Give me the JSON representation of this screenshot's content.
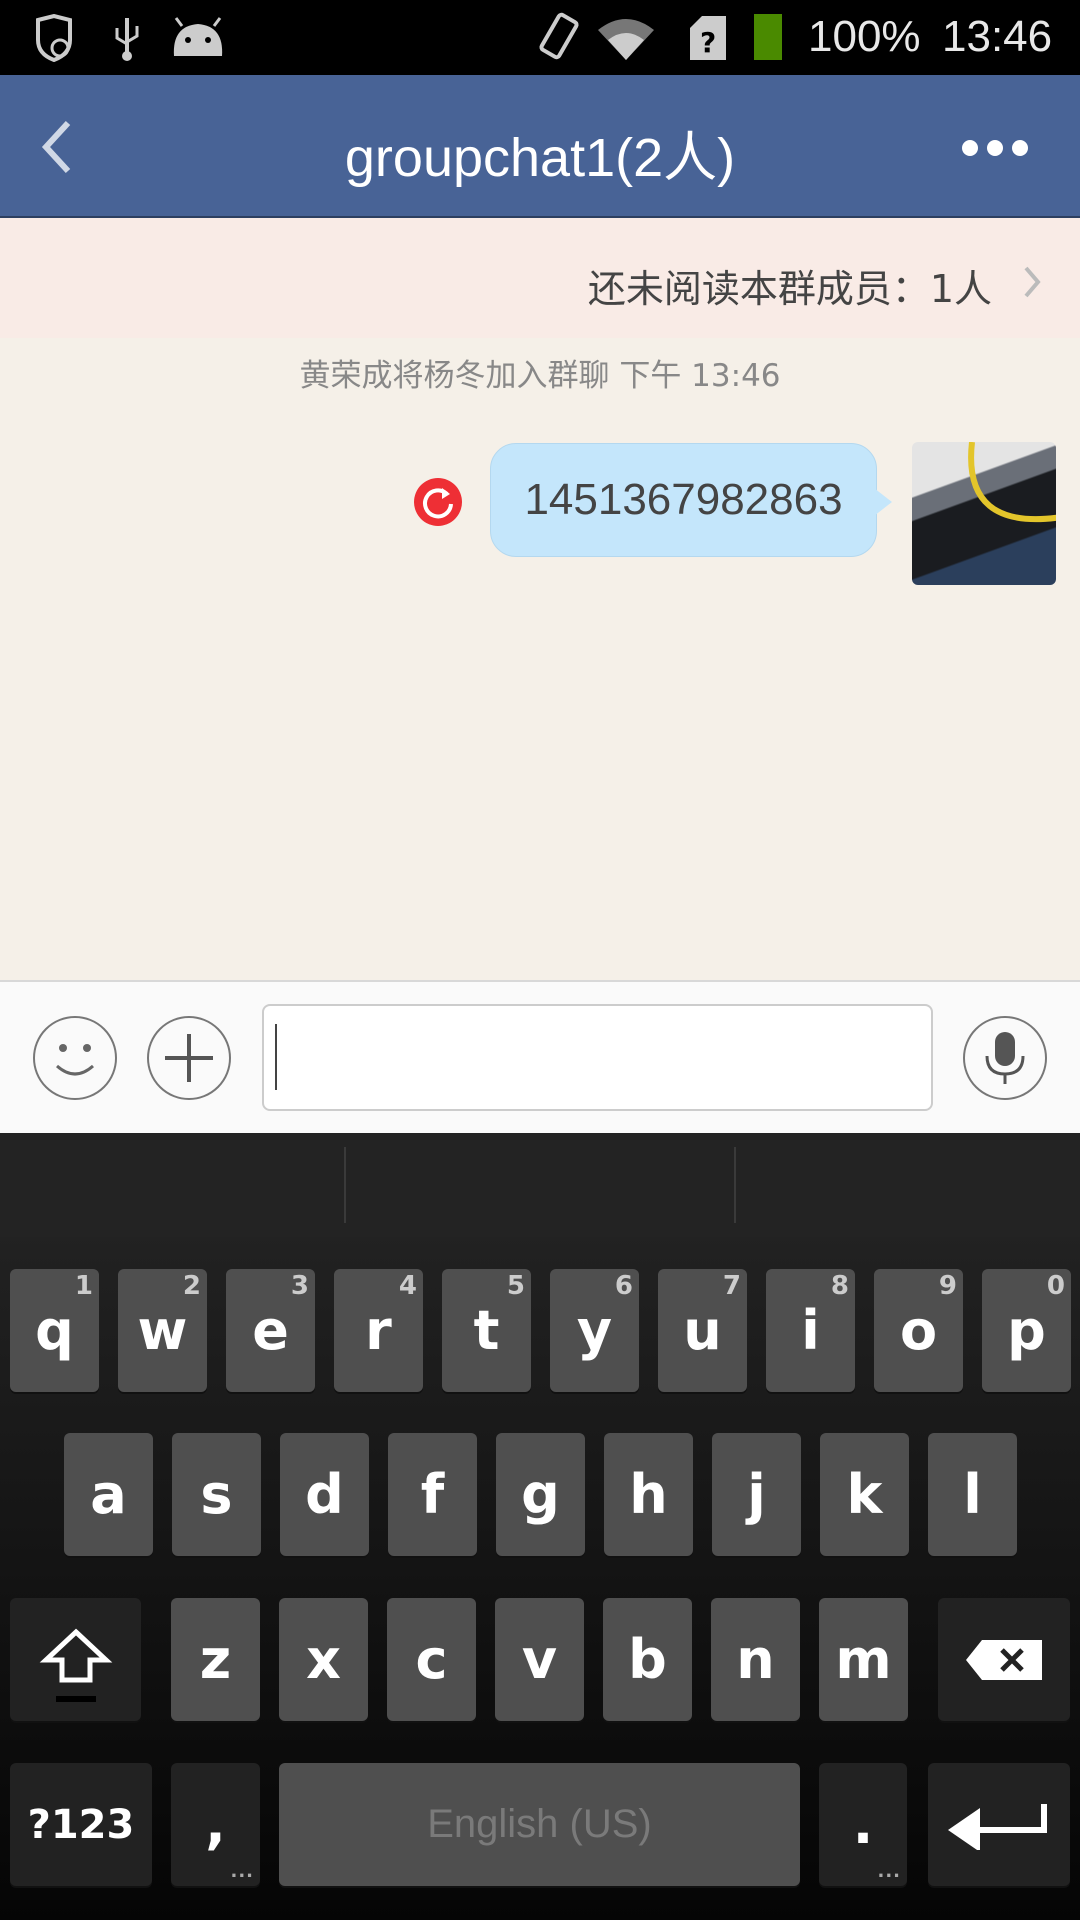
{
  "status_bar": {
    "battery": "100%",
    "time": "13:46",
    "icons": [
      "shield-icon",
      "usb-icon",
      "android-icon",
      "vibrate-icon",
      "wifi-icon",
      "sim-unknown-icon",
      "battery-icon"
    ],
    "battery_color": "#4a8a00"
  },
  "header": {
    "title": "groupchat1(2人)",
    "back_icon": "chevron-left-icon",
    "more_icon": "more-icon",
    "color": "#486396"
  },
  "unread_banner": {
    "text": "还未阅读本群成员：1人"
  },
  "messages": {
    "system": "黄荣成将杨冬加入群聊  下午 13:46",
    "sent": {
      "text": "1451367982863",
      "status_icon": "resend-icon",
      "status_color": "#ee2f35"
    }
  },
  "input_bar": {
    "value": "",
    "emoji_icon": "emoji-icon",
    "plus_icon": "plus-icon",
    "mic_icon": "mic-icon"
  },
  "keyboard": {
    "row1": [
      "q",
      "w",
      "e",
      "r",
      "t",
      "y",
      "u",
      "i",
      "o",
      "p"
    ],
    "row1_hints": [
      "1",
      "2",
      "3",
      "4",
      "5",
      "6",
      "7",
      "8",
      "9",
      "0"
    ],
    "row2": [
      "a",
      "s",
      "d",
      "f",
      "g",
      "h",
      "j",
      "k",
      "l"
    ],
    "row3": [
      "z",
      "x",
      "c",
      "v",
      "b",
      "n",
      "m"
    ],
    "symbols": "?123",
    "comma": ",",
    "space": "English (US)",
    "period": ".",
    "more_dots": "..."
  }
}
